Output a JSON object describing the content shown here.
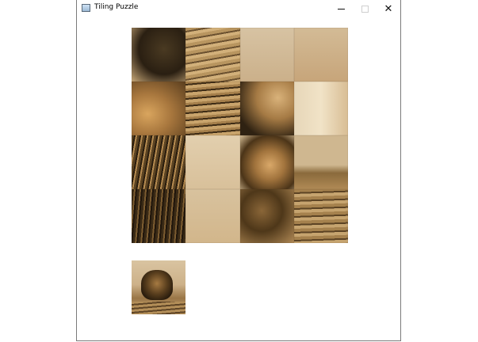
{
  "window": {
    "title": "Tiling Puzzle",
    "controls": {
      "minimize": "minimize-icon",
      "maximize": "maximize-icon",
      "close": "close-icon"
    }
  },
  "board": {
    "rows": 4,
    "cols": 4,
    "tiles": [
      "lion-mane-top",
      "rock-band",
      "sky",
      "sky",
      "lion-paw",
      "rock-lines",
      "rock-curve",
      "sky-bright",
      "lion-mane",
      "sky-plain",
      "lion-face",
      "sky-rock",
      "lion-mane-dark",
      "sky-low",
      "lion-mane-rock",
      "rock-bottom"
    ]
  },
  "preview": {
    "image": "lion-on-rock-thumbnail"
  },
  "colors": {
    "window_border": "#7a7a7a",
    "background": "#ffffff",
    "sepia_light": "#d7c3a3",
    "sepia_dark": "#2a1f12"
  }
}
